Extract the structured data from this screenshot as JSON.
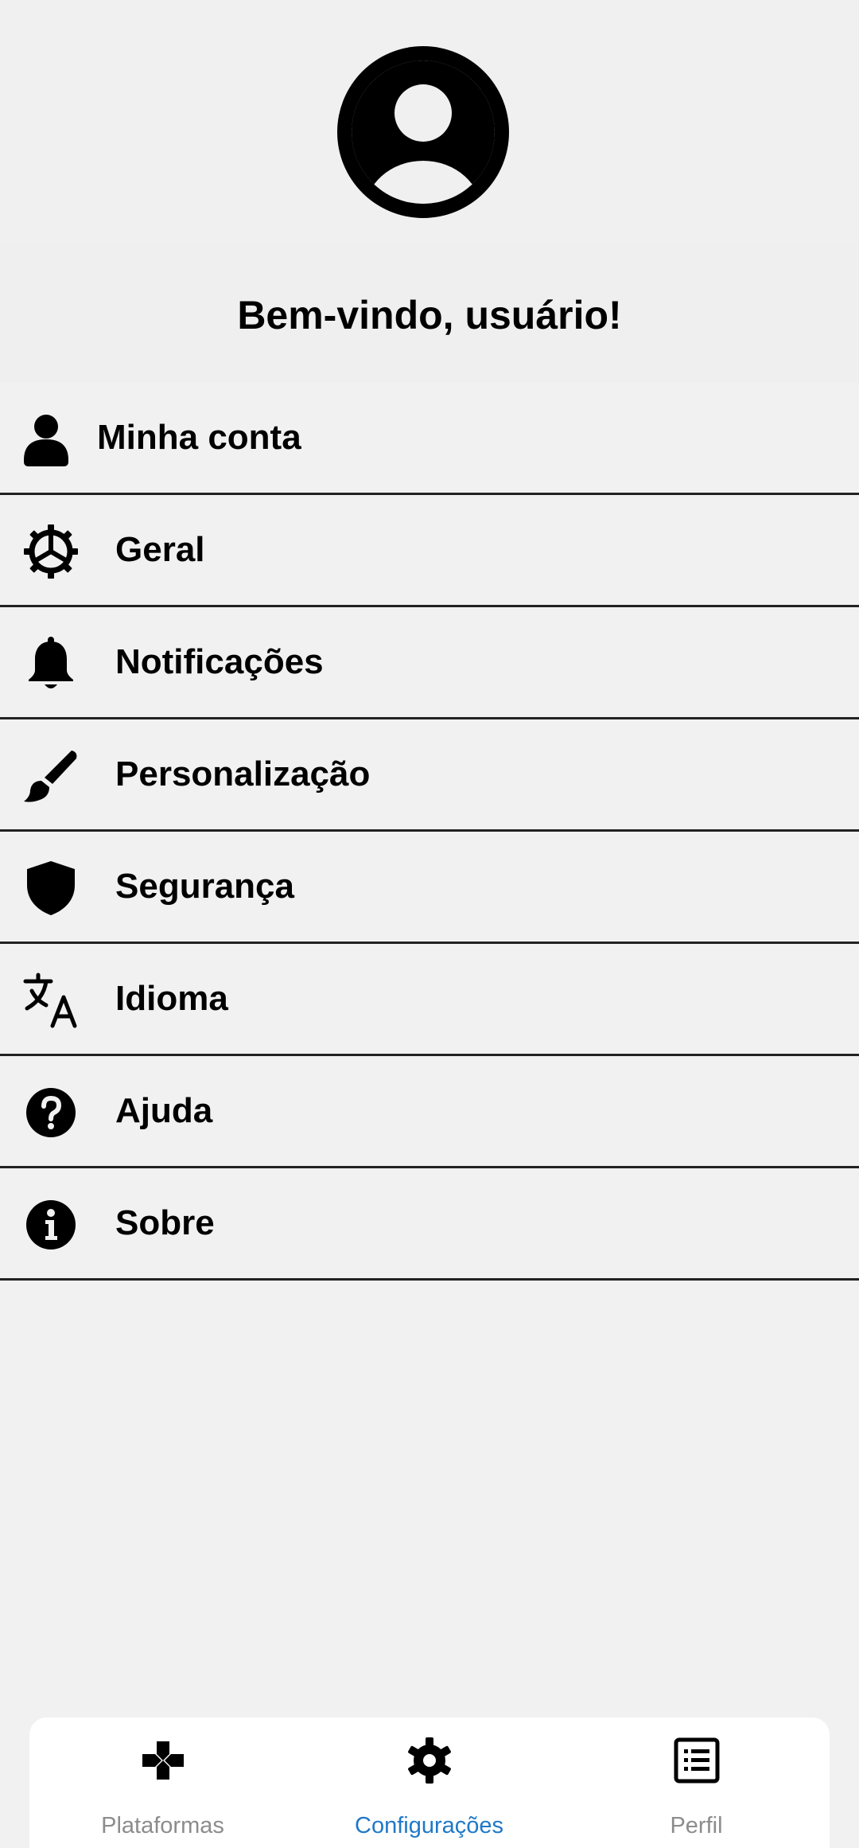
{
  "profile": {
    "avatar_icon": "account-circle-icon",
    "welcome": "Bem-vindo, usuário!"
  },
  "menu": {
    "items": [
      {
        "label": "Minha conta",
        "icon": "user-icon"
      },
      {
        "label": "Geral",
        "icon": "gear-icon"
      },
      {
        "label": "Notificações",
        "icon": "bell-icon"
      },
      {
        "label": "Personalização",
        "icon": "brush-icon"
      },
      {
        "label": "Segurança",
        "icon": "shield-icon"
      },
      {
        "label": "Idioma",
        "icon": "language-icon"
      },
      {
        "label": "Ajuda",
        "icon": "help-circle-icon"
      },
      {
        "label": "Sobre",
        "icon": "info-circle-icon"
      }
    ]
  },
  "bottom_nav": {
    "active_index": 1,
    "active_color": "#1f78c8",
    "inactive_color": "#8c8c8c",
    "items": [
      {
        "label": "Plataformas",
        "icon": "gamepad-icon"
      },
      {
        "label": "Configurações",
        "icon": "settings-icon"
      },
      {
        "label": "Perfil",
        "icon": "list-icon"
      }
    ]
  }
}
